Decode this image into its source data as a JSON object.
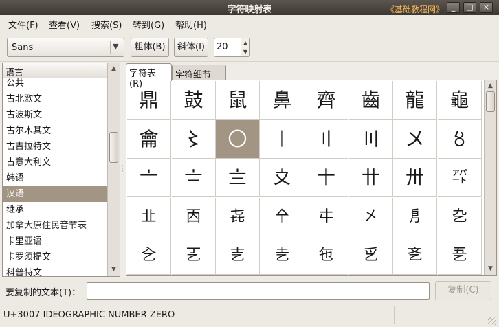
{
  "window": {
    "title": "字符映射表",
    "watermark": "《基础教程网》",
    "controls": {
      "minimize": "_",
      "maximize": "□",
      "close": "×"
    }
  },
  "menu": [
    "文件(F)",
    "查看(V)",
    "搜索(S)",
    "转到(G)",
    "帮助(H)"
  ],
  "toolbar": {
    "font_family": "Sans",
    "bold_label": "粗体(B)",
    "italic_label": "斜体(I)",
    "font_size": "20"
  },
  "languages": {
    "header": "语言",
    "items": [
      "公共",
      "古北欧文",
      "古波斯文",
      "古尔木其文",
      "古吉拉特文",
      "古意大利文",
      "韩语",
      "汉语",
      "继承",
      "加拿大原住民音节表",
      "卡里亚语",
      "卡罗须提文",
      "科普特文"
    ],
    "selected": "汉语"
  },
  "tabs": [
    "字符表(R)",
    "字符细节(D)"
  ],
  "char_grid": {
    "rows": [
      [
        "鼎",
        "鼓",
        "鼠",
        "鼻",
        "齊",
        "齒",
        "龍",
        "龜"
      ],
      [
        "龠",
        "〻",
        "〇",
        "〡",
        "〢",
        "〣",
        "〤",
        "〥"
      ],
      [
        "〦",
        "〧",
        "〨",
        "〩",
        "〸",
        "〹",
        "〺",
        "㌀"
      ],
      [
        "㐀",
        "㐁",
        "㐂",
        "㐃",
        "㐄",
        "㐅",
        "㐆",
        "㐇"
      ],
      [
        "㐈",
        "㐉",
        "㐊",
        "㐋",
        "㐌",
        "㐍",
        "㐎",
        "㐏"
      ]
    ],
    "selected": "〇"
  },
  "copy": {
    "label": "要复制的文本(T)：",
    "value": "",
    "button": "复制(C)"
  },
  "status": {
    "text": "U+3007 IDEOGRAPHIC NUMBER ZERO"
  }
}
